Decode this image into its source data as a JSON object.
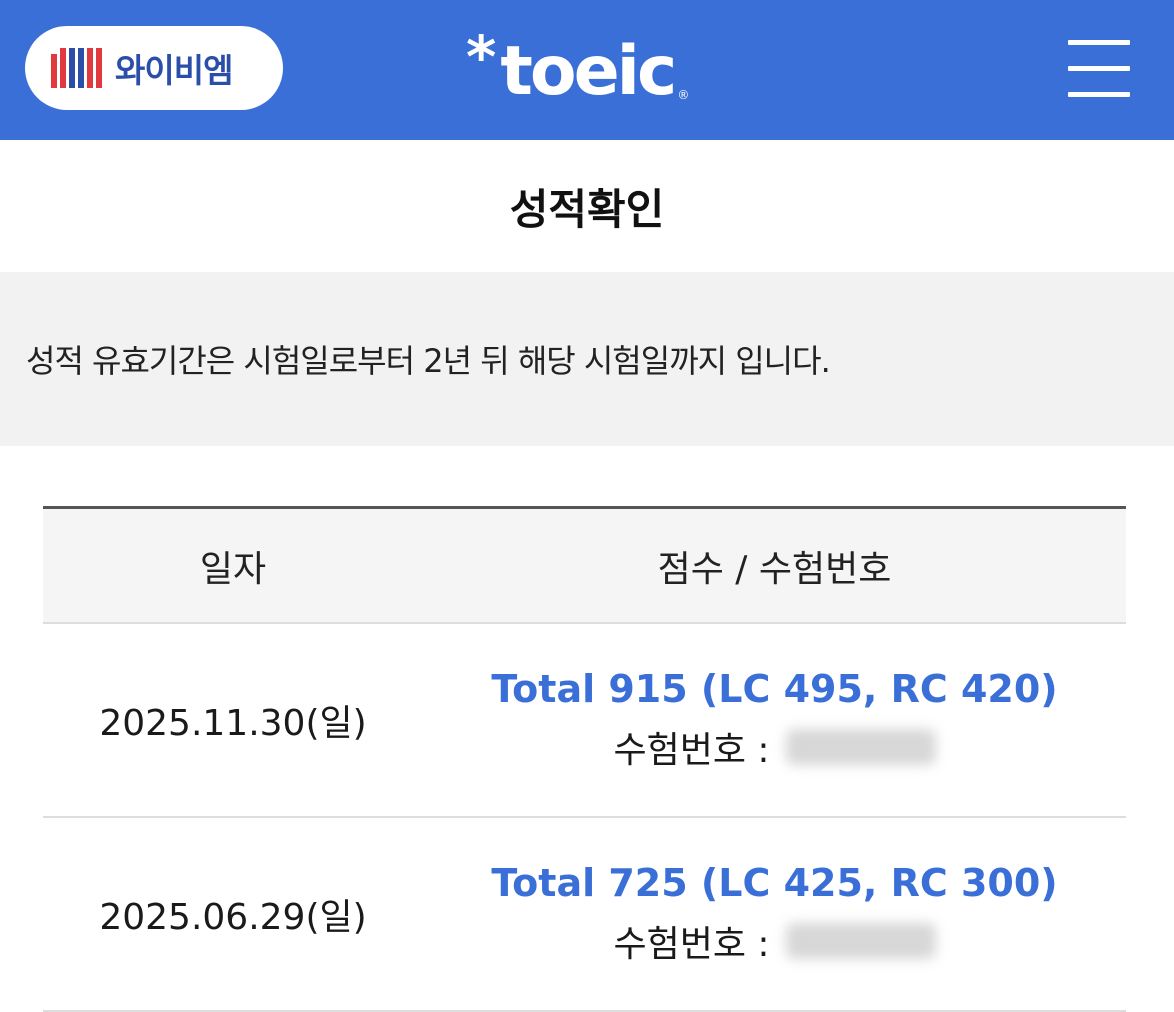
{
  "header": {
    "ybm_label": "와이비엠",
    "toeic_star": "*",
    "toeic_word": "toeic",
    "toeic_reg": "®",
    "menu_icon": "hamburger-icon",
    "background_color": "#3a6fd8"
  },
  "page": {
    "title": "성적확인",
    "notice": "성적 유효기간은 시험일로부터 2년 뒤 해당 시험일까지 입니다."
  },
  "table": {
    "columns": [
      "일자",
      "점수 / 수험번호"
    ],
    "rows": [
      {
        "date": "2025.11.30(일)",
        "score": "Total 915 (LC 495, RC 420)",
        "exam_label": "수험번호 :"
      },
      {
        "date": "2025.06.29(일)",
        "score": "Total 725 (LC 425, RC 300)",
        "exam_label": "수험번호 :"
      }
    ]
  },
  "colors": {
    "accent": "#3a6fd8",
    "ybm_red": "#e03a3e",
    "ybm_blue": "#2b4fa8"
  }
}
